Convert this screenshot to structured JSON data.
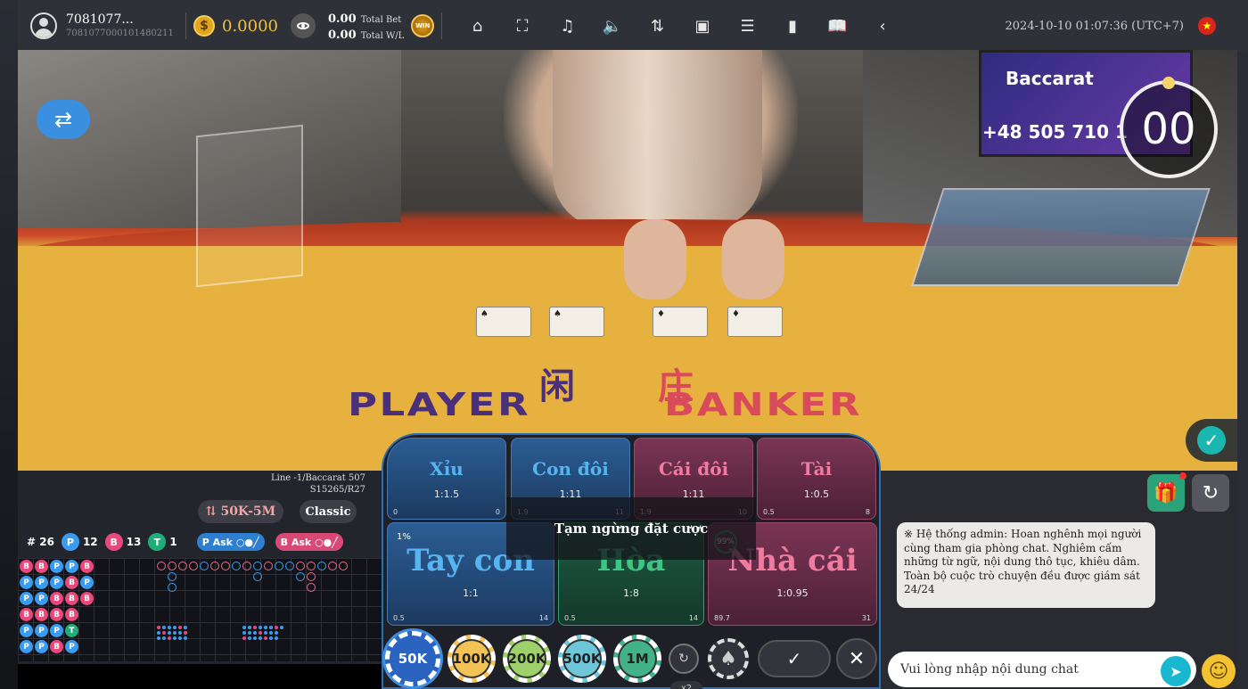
{
  "header": {
    "username": "7081077...",
    "user_id": "7081077000101480211",
    "balance": "0.0000",
    "coin_symbol": "$",
    "total_bet_value": "0.00",
    "total_bet_label": "Total Bet",
    "total_wl_value": "0.00",
    "total_wl_label": "Total W/L",
    "win_badge": "WIN",
    "datetime": "2024-10-10 01:07:36 (UTC+7)",
    "flag_star": "★",
    "icons": [
      {
        "name": "home-icon",
        "glyph": "⌂"
      },
      {
        "name": "fullscreen-icon",
        "glyph": "⛶"
      },
      {
        "name": "music-off-icon",
        "glyph": "♫"
      },
      {
        "name": "volume-icon",
        "glyph": "🔈"
      },
      {
        "name": "sort-icon",
        "glyph": "⇅"
      },
      {
        "name": "video-icon",
        "glyph": "▣"
      },
      {
        "name": "settings-sliders-icon",
        "glyph": "☰"
      },
      {
        "name": "stats-icon",
        "glyph": "▮"
      },
      {
        "name": "book-icon",
        "glyph": "📖"
      },
      {
        "name": "chevron-left-icon",
        "glyph": "‹"
      }
    ]
  },
  "video": {
    "sync_glyph": "⇄",
    "monitor_title": "Baccarat",
    "monitor_phone": "+48 505 710 1",
    "timer": "00",
    "player_zh": "闲",
    "banker_zh": "庄",
    "player_label": "PLAYER",
    "banker_label": "BANKER",
    "verify_glyph": "✓"
  },
  "road": {
    "line_info": "Line -1/Baccarat 507",
    "shoe_info": "S15265/R27",
    "limit": "⇅ 50K-5M",
    "mode": "Classic",
    "round_count": "# 26",
    "player_letter": "P",
    "player_count": "12",
    "banker_letter": "B",
    "banker_count": "13",
    "tie_letter": "T",
    "tie_count": "1",
    "p_ask": "P Ask",
    "b_ask": "B Ask",
    "beads": [
      [
        "B",
        "P",
        "P",
        "B",
        "P",
        "P"
      ],
      [
        "B",
        "P",
        "P",
        "B",
        "P",
        "P"
      ],
      [
        "P",
        "P",
        "B",
        "B",
        "P",
        "B"
      ],
      [
        "P",
        "B",
        "B",
        "B",
        "T",
        "P"
      ],
      [
        "B",
        "P",
        "B"
      ]
    ],
    "colors": {
      "banker": "#e8497a",
      "player": "#3a9cf0",
      "tie": "#1fae7a"
    }
  },
  "bets": {
    "top": [
      {
        "name": "Xỉu",
        "odds": "1:1.5",
        "left": "0",
        "right": "0",
        "color": "blue"
      },
      {
        "name": "Con đôi",
        "odds": "1:11",
        "left": "1.9",
        "right": "11",
        "color": "blue"
      },
      {
        "name": "Cái đôi",
        "odds": "1:11",
        "left": "1.9",
        "right": "10",
        "color": "red"
      },
      {
        "name": "Tài",
        "odds": "1:0.5",
        "left": "0.5",
        "right": "8",
        "color": "red"
      }
    ],
    "bottom": [
      {
        "name": "Tay con",
        "odds": "1:1",
        "left": "0.5",
        "right": "14",
        "badge": "1%"
      },
      {
        "name": "Hòa",
        "odds": "1:8",
        "left": "0.5",
        "right": "14"
      },
      {
        "name": "Nhà cái",
        "odds": "1:0.95",
        "left": "89.7",
        "right": "31",
        "badge": "99%"
      }
    ],
    "suspended_text": "Tạm ngừng đặt cược"
  },
  "chips": {
    "values": [
      "50K",
      "100K",
      "200K",
      "500K",
      "1M"
    ],
    "selected": "50K",
    "repeat_glyph": "↻",
    "double_label": "x2",
    "spade_glyph": "♠",
    "confirm_glyph": "✓",
    "cancel_glyph": "✕"
  },
  "chat": {
    "gift_glyph": "🎁",
    "refresh_glyph": "↻",
    "admin_message": "※ Hệ thống admin: Hoan nghênh mọi người cùng tham gia phòng chat. Nghiêm cấm những từ ngữ, nội dung thô tục, khiêu dâm. Toàn bộ cuộc trò chuyện đều được giám sát 24/24",
    "placeholder": "Vui lòng nhập nội dung chat",
    "send_glyph": "➤",
    "emoji_glyph": "☺"
  }
}
